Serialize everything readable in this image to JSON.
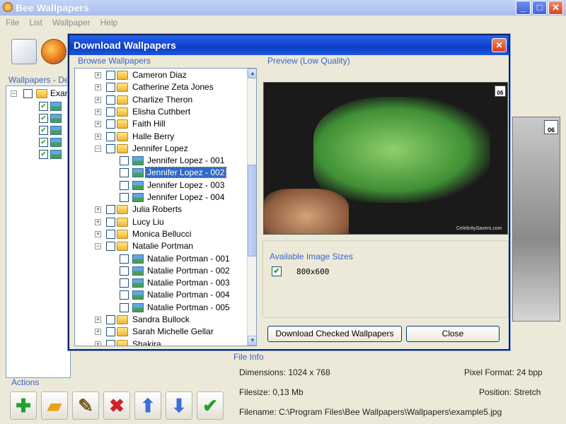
{
  "app": {
    "title": "Bee Wallpapers"
  },
  "menu": [
    "File",
    "List",
    "Wallpaper",
    "Help"
  ],
  "left_panel": {
    "label": "Wallpapers - De",
    "root_label": "Exar"
  },
  "actions": {
    "label": "Actions"
  },
  "file_info": {
    "label": "File Info",
    "dimensions": "Dimensions: 1024 x 768",
    "pixel_format": "Pixel Format: 24 bpp",
    "filesize": "Filesize: 0,13 Mb",
    "position": "Position: Stretch",
    "filename": "Filename: C:\\Program Files\\Bee Wallpapers\\Wallpapers\\example5.jpg"
  },
  "dialog": {
    "title": "Download Wallpapers",
    "browse_label": "Browse Wallpapers",
    "preview_label": "Preview (Low Quality)",
    "preview_watermark": "CelebritySavers.com",
    "calendar_day": "06",
    "sizes_label": "Available Image Sizes",
    "size_value": "800x600",
    "download_button": "Download Checked Wallpapers",
    "close_button": "Close"
  },
  "tree": [
    {
      "label": "Cameron Diaz",
      "type": "folder",
      "expanded": false
    },
    {
      "label": "Catherine Zeta Jones",
      "type": "folder",
      "expanded": false
    },
    {
      "label": "Charlize Theron",
      "type": "folder",
      "expanded": false
    },
    {
      "label": "Elisha Cuthbert",
      "type": "folder",
      "expanded": false
    },
    {
      "label": "Faith Hill",
      "type": "folder",
      "expanded": false
    },
    {
      "label": "Halle Berry",
      "type": "folder",
      "expanded": false
    },
    {
      "label": "Jennifer Lopez",
      "type": "folder",
      "expanded": true
    },
    {
      "label": "Jennifer Lopez - 001",
      "type": "image"
    },
    {
      "label": "Jennifer Lopez - 002",
      "type": "image",
      "selected": true
    },
    {
      "label": "Jennifer Lopez - 003",
      "type": "image"
    },
    {
      "label": "Jennifer Lopez - 004",
      "type": "image"
    },
    {
      "label": "Julia Roberts",
      "type": "folder",
      "expanded": false
    },
    {
      "label": "Lucy Liu",
      "type": "folder",
      "expanded": false
    },
    {
      "label": "Monica Bellucci",
      "type": "folder",
      "expanded": false
    },
    {
      "label": "Natalie Portman",
      "type": "folder",
      "expanded": true
    },
    {
      "label": "Natalie Portman - 001",
      "type": "image"
    },
    {
      "label": "Natalie Portman - 002",
      "type": "image"
    },
    {
      "label": "Natalie Portman - 003",
      "type": "image"
    },
    {
      "label": "Natalie Portman - 004",
      "type": "image"
    },
    {
      "label": "Natalie Portman - 005",
      "type": "image"
    },
    {
      "label": "Sandra Bullock",
      "type": "folder",
      "expanded": false
    },
    {
      "label": "Sarah Michelle Gellar",
      "type": "folder",
      "expanded": false
    },
    {
      "label": "Shakira",
      "type": "folder",
      "expanded": false
    }
  ],
  "colors": {
    "title_bar": "#0a3fc8",
    "selection": "#316ac5",
    "group_label": "#3a64c8"
  }
}
